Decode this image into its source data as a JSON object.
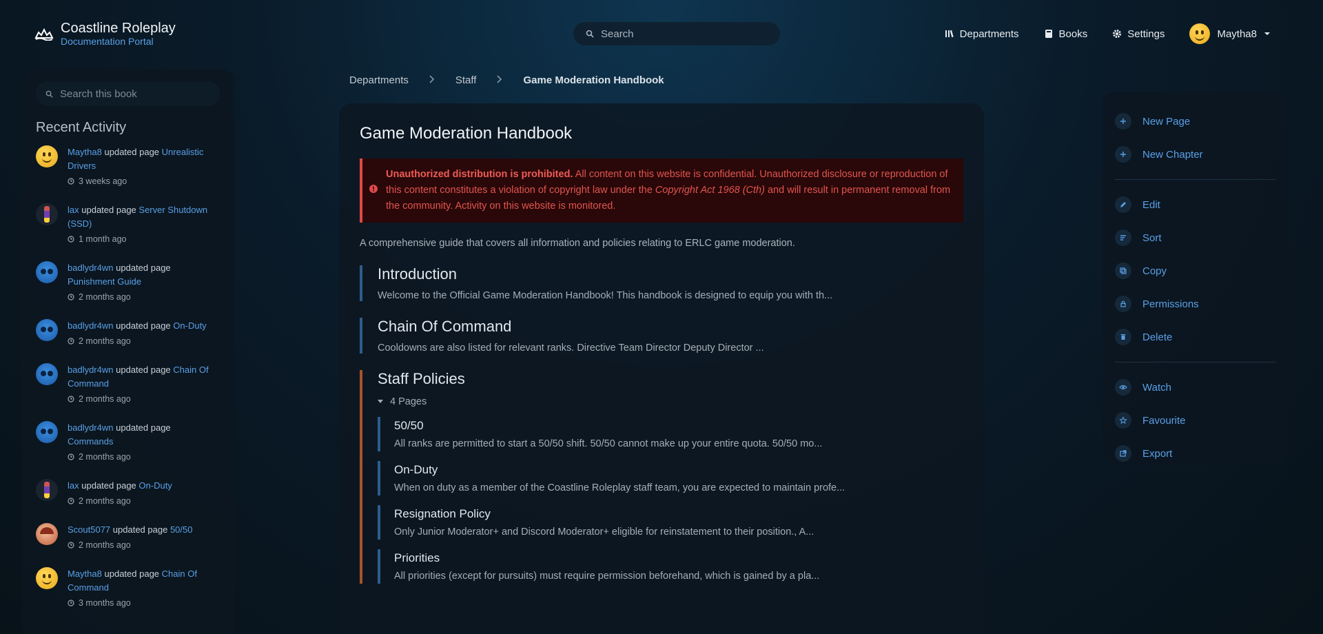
{
  "header": {
    "brand_title": "Coastline Roleplay",
    "brand_subtitle": "Documentation Portal",
    "search_placeholder": "Search",
    "nav": [
      {
        "label": "Departments",
        "icon": "departments-icon"
      },
      {
        "label": "Books",
        "icon": "books-icon"
      },
      {
        "label": "Settings",
        "icon": "gear-icon"
      }
    ],
    "user_name": "Maytha8"
  },
  "sidebar": {
    "search_placeholder": "Search this book",
    "recent_title": "Recent Activity",
    "activity": [
      {
        "user": "Maytha8",
        "action": "updated page",
        "page": "Unrealistic Drivers",
        "time": "3 weeks ago",
        "avatar": "emoji"
      },
      {
        "user": "lax",
        "action": "updated page",
        "page": "Server Shutdown (SSD)",
        "time": "1 month ago",
        "avatar": "lax"
      },
      {
        "user": "badlydr4wn",
        "action": "updated page",
        "page": "Punishment Guide",
        "time": "2 months ago",
        "avatar": "blue"
      },
      {
        "user": "badlydr4wn",
        "action": "updated page",
        "page": "On-Duty",
        "time": "2 months ago",
        "avatar": "blue"
      },
      {
        "user": "badlydr4wn",
        "action": "updated page",
        "page": "Chain Of Command",
        "time": "2 months ago",
        "avatar": "blue"
      },
      {
        "user": "badlydr4wn",
        "action": "updated page",
        "page": "Commands",
        "time": "2 months ago",
        "avatar": "blue"
      },
      {
        "user": "lax",
        "action": "updated page",
        "page": "On-Duty",
        "time": "2 months ago",
        "avatar": "lax"
      },
      {
        "user": "Scout5077",
        "action": "updated page",
        "page": "50/50",
        "time": "2 months ago",
        "avatar": "scout"
      },
      {
        "user": "Maytha8",
        "action": "updated page",
        "page": "Chain Of Command",
        "time": "3 months ago",
        "avatar": "emoji"
      }
    ]
  },
  "breadcrumb": [
    "Departments",
    "Staff",
    "Game Moderation Handbook"
  ],
  "main": {
    "title": "Game Moderation Handbook",
    "alert": {
      "strong": "Unauthorized distribution is prohibited.",
      "text1": " All content on this website is confidential. Unauthorized disclosure or reproduction of this content constitutes a violation of copyright law under the ",
      "em": "Copyright Act 1968 (Cth)",
      "text2": " and will result in permanent removal from the community. Activity on this website is monitored."
    },
    "intro": "A comprehensive guide that covers all information and policies relating to ERLC game moderation.",
    "entries": [
      {
        "title": "Introduction",
        "desc": "Welcome to the Official Game Moderation Handbook! This handbook is designed to equip you with th..."
      },
      {
        "title": "Chain Of Command",
        "desc": "Cooldowns are also listed for relevant ranks. Directive Team Director Deputy Director ..."
      }
    ],
    "chapter": {
      "title": "Staff Policies",
      "pages_label": "4 Pages",
      "pages": [
        {
          "title": "50/50",
          "desc": "All ranks are permitted to start a 50/50 shift. 50/50 cannot make up your entire quota. 50/50 mo..."
        },
        {
          "title": "On-Duty",
          "desc": "When on duty as a member of the Coastline Roleplay staff team, you are expected to maintain profe..."
        },
        {
          "title": "Resignation Policy",
          "desc": "Only Junior Moderator+ and Discord Moderator+ eligible for reinstatement to their position., A..."
        },
        {
          "title": "Priorities",
          "desc": "All priorities (except for pursuits) must require permission beforehand, which is gained by a pla..."
        }
      ]
    }
  },
  "actions": {
    "group1": [
      {
        "label": "New Page",
        "icon": "plus-icon"
      },
      {
        "label": "New Chapter",
        "icon": "plus-icon"
      }
    ],
    "group2": [
      {
        "label": "Edit",
        "icon": "pencil-icon"
      },
      {
        "label": "Sort",
        "icon": "sort-icon"
      },
      {
        "label": "Copy",
        "icon": "copy-icon"
      },
      {
        "label": "Permissions",
        "icon": "lock-icon"
      },
      {
        "label": "Delete",
        "icon": "trash-icon"
      }
    ],
    "group3": [
      {
        "label": "Watch",
        "icon": "eye-icon"
      },
      {
        "label": "Favourite",
        "icon": "star-icon"
      },
      {
        "label": "Export",
        "icon": "export-icon"
      }
    ]
  },
  "colors": {
    "link": "#5aa0e6",
    "alert_bg": "#2a0708",
    "alert_border": "#e04a4a",
    "chapter_border": "#a8532a",
    "page_border": "#2e5d8c"
  }
}
